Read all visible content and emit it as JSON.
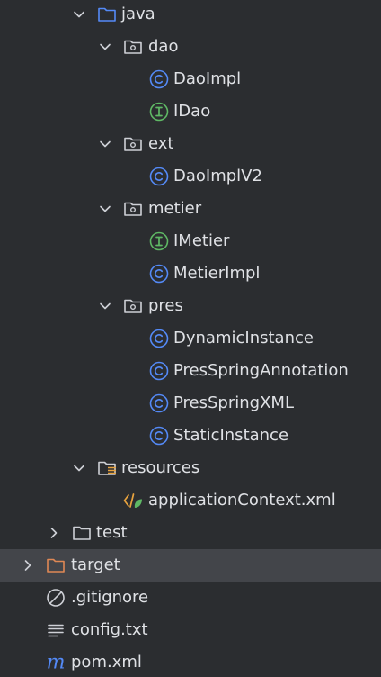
{
  "tree": [
    {
      "label": "java",
      "icon": "folder-source",
      "expanded": true
    },
    {
      "label": "dao",
      "icon": "package",
      "expanded": true
    },
    {
      "label": "DaoImpl",
      "icon": "class"
    },
    {
      "label": "IDao",
      "icon": "interface"
    },
    {
      "label": "ext",
      "icon": "package",
      "expanded": true
    },
    {
      "label": "DaoImplV2",
      "icon": "class"
    },
    {
      "label": "metier",
      "icon": "package",
      "expanded": true
    },
    {
      "label": "IMetier",
      "icon": "interface"
    },
    {
      "label": "MetierImpl",
      "icon": "class"
    },
    {
      "label": "pres",
      "icon": "package",
      "expanded": true
    },
    {
      "label": "DynamicInstance",
      "icon": "class"
    },
    {
      "label": "PresSpringAnnotation",
      "icon": "class"
    },
    {
      "label": "PresSpringXML",
      "icon": "class"
    },
    {
      "label": "StaticInstance",
      "icon": "class"
    },
    {
      "label": "resources",
      "icon": "folder-resources",
      "expanded": true
    },
    {
      "label": "applicationContext.xml",
      "icon": "xml"
    },
    {
      "label": "test",
      "icon": "folder",
      "expanded": false
    },
    {
      "label": "target",
      "icon": "folder-excluded",
      "expanded": false,
      "selected": true
    },
    {
      "label": ".gitignore",
      "icon": "ignore-file"
    },
    {
      "label": "config.txt",
      "icon": "text-file"
    },
    {
      "label": "pom.xml",
      "icon": "maven"
    }
  ],
  "colors": {
    "background": "#2b2d30",
    "selection": "#43454a",
    "text": "#dfe1e5",
    "folder_blue": "#548af7",
    "class_blue": "#548af7",
    "interface_green": "#5fb865",
    "excluded_orange": "#e08855",
    "xml_orange": "#e8a33e",
    "gray_icon": "#ced0d6"
  }
}
